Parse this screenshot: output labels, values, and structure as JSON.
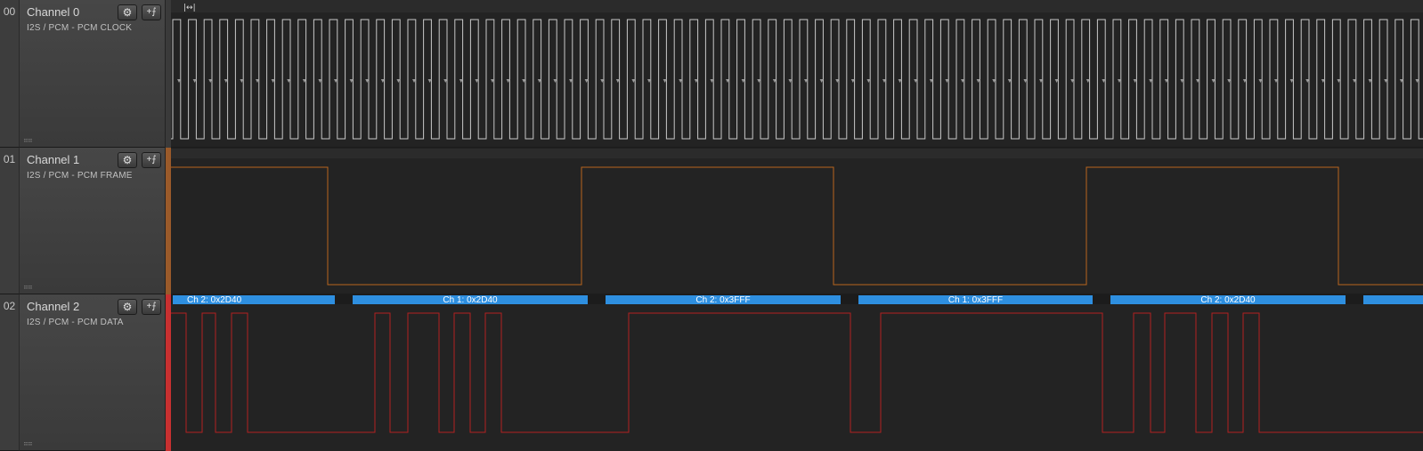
{
  "channels": [
    {
      "index": "00",
      "name": "Channel 0",
      "analyzer": "I2S / PCM - PCM CLOCK",
      "color": "#c8c8c8",
      "strip_color": "#3a3a3a"
    },
    {
      "index": "01",
      "name": "Channel 1",
      "analyzer": "I2S / PCM - PCM FRAME",
      "color": "#b8651e",
      "strip_color": "#9a5a2a"
    },
    {
      "index": "02",
      "name": "Channel 2",
      "analyzer": "I2S / PCM - PCM DATA",
      "color": "#b32020",
      "strip_color": "#c83030"
    }
  ],
  "icons": {
    "gear": "gear-icon",
    "trigger": "trigger-icon",
    "grip": "drag-grip-icon",
    "marker": "timing-marker-icon"
  },
  "decoded_frames": [
    {
      "label": "Ch 2: 0x2D40"
    },
    {
      "label": "Ch 1: 0x2D40"
    },
    {
      "label": "Ch 2: 0x3FFF"
    },
    {
      "label": "Ch 1: 0x3FFF"
    },
    {
      "label": "Ch 2: 0x2D40"
    },
    {
      "label": ""
    }
  ],
  "colors": {
    "background": "#232323",
    "decode_bar": "#2e8fe0",
    "decode_gap": "#1c1c1c"
  }
}
